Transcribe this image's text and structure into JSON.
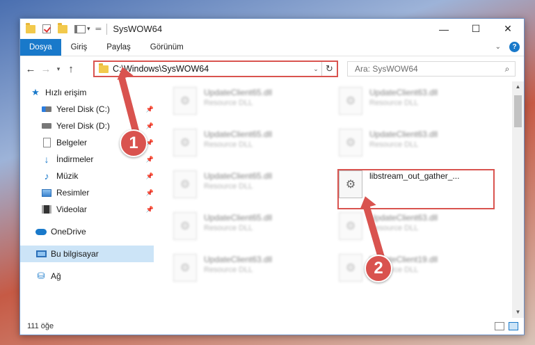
{
  "window": {
    "title": "SysWOW64",
    "controls": {
      "minimize": "—",
      "maximize": "☐",
      "close": "✕"
    }
  },
  "ribbon": {
    "tabs": [
      "Dosya",
      "Giriş",
      "Paylaş",
      "Görünüm"
    ],
    "help": "?"
  },
  "address": {
    "path": "C:\\Windows\\SysWOW64",
    "search_placeholder": "Ara: SysWOW64"
  },
  "sidebar": {
    "quick_access": "Hızlı erişim",
    "items": [
      {
        "label": "Yerel Disk (C:)",
        "pinned": true
      },
      {
        "label": "Yerel Disk (D:)",
        "pinned": true
      },
      {
        "label": "Belgeler",
        "pinned": true
      },
      {
        "label": "İndirmeler",
        "pinned": true
      },
      {
        "label": "Müzik",
        "pinned": true
      },
      {
        "label": "Resimler",
        "pinned": true
      },
      {
        "label": "Videolar",
        "pinned": true
      }
    ],
    "onedrive": "OneDrive",
    "this_pc": "Bu bilgisayar",
    "network": "Ağ"
  },
  "files": [
    {
      "name": "UpdateClient65.dll",
      "type": "Resource DLL"
    },
    {
      "name": "UpdateClient63.dll",
      "type": "Resource DLL"
    },
    {
      "name": "UpdateClient65.dll",
      "type": "Resource DLL"
    },
    {
      "name": "UpdateClient63.dll",
      "type": "Resource DLL"
    },
    {
      "name": "UpdateClient65.dll",
      "type": "Resource DLL"
    },
    {
      "name": "libstream_out_gather_...",
      "type": ""
    },
    {
      "name": "UpdateClient65.dll",
      "type": "Resource DLL"
    },
    {
      "name": "UpdateClient63.dll",
      "type": "Resource DLL"
    },
    {
      "name": "UpdateClient63.dll",
      "type": "Resource DLL"
    },
    {
      "name": "UpdateClient19.dll",
      "type": "Resource DLL"
    }
  ],
  "status": {
    "count": "111 öğe"
  },
  "annotations": {
    "step1": "1",
    "step2": "2",
    "color": "#d9534f"
  }
}
